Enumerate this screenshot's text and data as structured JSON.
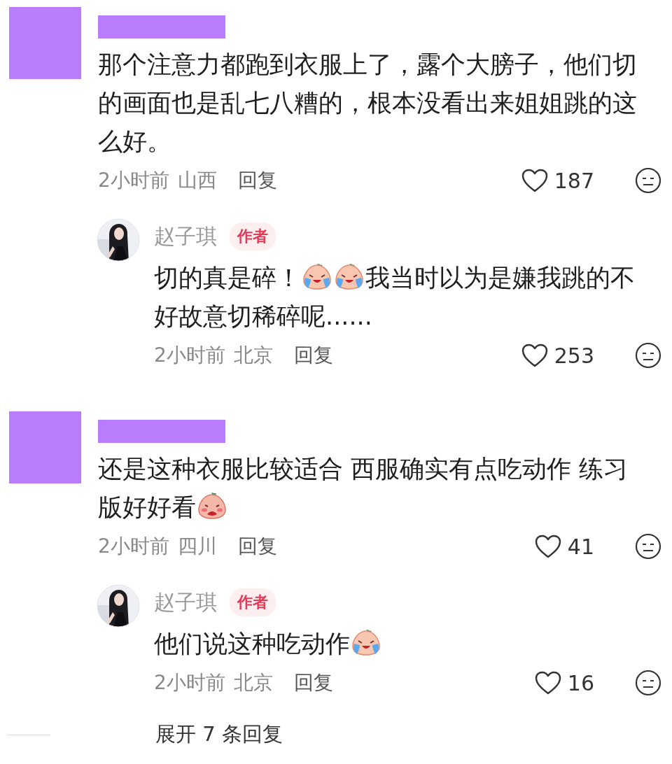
{
  "comments": [
    {
      "kind": "comment",
      "content": [
        {
          "kind": "text",
          "text": "那个注意力都跑到衣服上了，露个大膀子，他们切的画面也是乱七八糟的，根本没看出来姐姐跳的这么好。"
        }
      ],
      "time": "2小时前",
      "location": "山西",
      "reply_label": "回复",
      "likes": "187",
      "replies": [
        {
          "kind": "reply",
          "name": "赵子琪",
          "badge": "作者",
          "content": [
            {
              "kind": "text",
              "text": "切的真是碎！"
            },
            {
              "kind": "crying"
            },
            {
              "kind": "crying"
            },
            {
              "kind": "text",
              "text": "我当时以为是嫌我跳的不好故意切稀碎呢......"
            }
          ],
          "time": "2小时前",
          "location": "北京",
          "reply_label": "回复",
          "likes": "253"
        }
      ]
    },
    {
      "kind": "comment",
      "content": [
        {
          "kind": "text",
          "text": "还是这种衣服比较适合 西服确实有点吃动作 练习版好好看"
        },
        {
          "kind": "shy"
        }
      ],
      "time": "2小时前",
      "location": "四川",
      "reply_label": "回复",
      "likes": "41",
      "replies": [
        {
          "kind": "reply",
          "name": "赵子琪",
          "badge": "作者",
          "content": [
            {
              "kind": "text",
              "text": "他们说这种吃动作"
            },
            {
              "kind": "crying"
            }
          ],
          "time": "2小时前",
          "location": "北京",
          "reply_label": "回复",
          "likes": "16"
        }
      ],
      "expand_replies": "展开 7 条回复"
    }
  ]
}
